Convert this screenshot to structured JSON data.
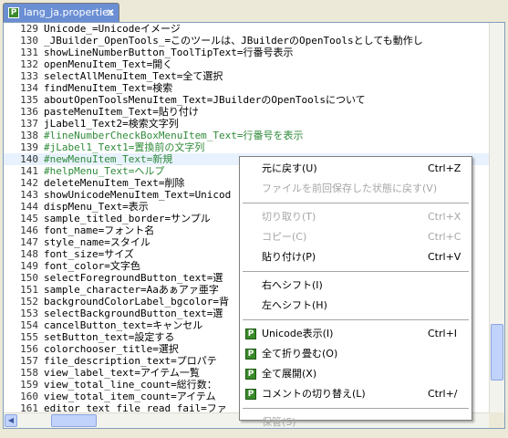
{
  "tab": {
    "label": "lang_ja.properties",
    "icon": "properties-file-icon",
    "close": "✕",
    "file_badge": "P"
  },
  "editor": {
    "lines": [
      {
        "n": "129",
        "text": "Unicode_=Unicodeイメージ",
        "comment": false
      },
      {
        "n": "130",
        "text": "_JBuilder_OpenTools_=このツールは、JBuilderのOpenToolsとしても動作し",
        "comment": false
      },
      {
        "n": "131",
        "text": "showLineNumberButton_ToolTipText=行番号表示",
        "comment": false
      },
      {
        "n": "132",
        "text": "openMenuItem_Text=開く",
        "comment": false
      },
      {
        "n": "133",
        "text": "selectAllMenuItem_Text=全て選択",
        "comment": false
      },
      {
        "n": "134",
        "text": "findMenuItem_Text=検索",
        "comment": false
      },
      {
        "n": "135",
        "text": "aboutOpenToolsMenuItem_Text=JBuilderのOpenToolsについて",
        "comment": false
      },
      {
        "n": "136",
        "text": "pasteMenuItem_Text=貼り付け",
        "comment": false
      },
      {
        "n": "137",
        "text": "jLabel1_Text2=検索文字列",
        "comment": false
      },
      {
        "n": "138",
        "text": "#lineNumberCheckBoxMenuItem_Text=行番号を表示",
        "comment": true
      },
      {
        "n": "139",
        "text": "#jLabel1_Text1=置換前の文字列",
        "comment": true
      },
      {
        "n": "140",
        "text": "#newMenuItem_Text=新規",
        "comment": true
      },
      {
        "n": "141",
        "text": "#helpMenu_Text=ヘルプ",
        "comment": true
      },
      {
        "n": "142",
        "text": "deleteMenuItem_Text=削除",
        "comment": false
      },
      {
        "n": "143",
        "text": "showUnicodeMenuItem_Text=Unicod",
        "comment": false
      },
      {
        "n": "144",
        "text": "dispMenu_Text=表示",
        "comment": false
      },
      {
        "n": "145",
        "text": "sample_titled_border=サンプル",
        "comment": false
      },
      {
        "n": "146",
        "text": "font_name=フォント名",
        "comment": false
      },
      {
        "n": "147",
        "text": "style_name=スタイル",
        "comment": false
      },
      {
        "n": "148",
        "text": "font_size=サイズ",
        "comment": false
      },
      {
        "n": "149",
        "text": "font_color=文字色",
        "comment": false
      },
      {
        "n": "150",
        "text": "selectForegroundButton_text=選",
        "comment": false
      },
      {
        "n": "151",
        "text": "sample_character=Aaあぁアァ亜字",
        "comment": false
      },
      {
        "n": "152",
        "text": "backgroundColorLabel_bgcolor=背",
        "comment": false
      },
      {
        "n": "153",
        "text": "selectBackgroundButton_text=選",
        "comment": false
      },
      {
        "n": "154",
        "text": "cancelButton_text=キャンセル",
        "comment": false
      },
      {
        "n": "155",
        "text": "setButton_text=設定する",
        "comment": false
      },
      {
        "n": "156",
        "text": "colorchooser_title=選択",
        "comment": false
      },
      {
        "n": "157",
        "text": "file_description_text=プロパテ",
        "comment": false
      },
      {
        "n": "158",
        "text": "view_label_text=アイテム一覧",
        "comment": false
      },
      {
        "n": "159",
        "text": "view_total_line_count=総行数：",
        "comment": false
      },
      {
        "n": "160",
        "text": "view_total_item_count=アイテム",
        "comment": false
      },
      {
        "n": "161",
        "text": "editor_text_file_read_fail=ファ",
        "comment": false
      }
    ],
    "current_line_index": 11
  },
  "context_menu": {
    "items": [
      {
        "type": "item",
        "label": "元に戻す(U)",
        "shortcut": "Ctrl+Z",
        "enabled": true,
        "icon": ""
      },
      {
        "type": "item",
        "label": "ファイルを前回保存した状態に戻す(V)",
        "shortcut": "",
        "enabled": false,
        "icon": ""
      },
      {
        "type": "separator"
      },
      {
        "type": "item",
        "label": "切り取り(T)",
        "shortcut": "Ctrl+X",
        "enabled": false,
        "icon": ""
      },
      {
        "type": "item",
        "label": "コピー(C)",
        "shortcut": "Ctrl+C",
        "enabled": false,
        "icon": ""
      },
      {
        "type": "item",
        "label": "貼り付け(P)",
        "shortcut": "Ctrl+V",
        "enabled": true,
        "icon": ""
      },
      {
        "type": "separator"
      },
      {
        "type": "item",
        "label": "右へシフト(I)",
        "shortcut": "",
        "enabled": true,
        "icon": ""
      },
      {
        "type": "item",
        "label": "左へシフト(H)",
        "shortcut": "",
        "enabled": true,
        "icon": ""
      },
      {
        "type": "separator"
      },
      {
        "type": "item",
        "label": "Unicode表示(I)",
        "shortcut": "Ctrl+I",
        "enabled": true,
        "icon": "plugin-icon"
      },
      {
        "type": "item",
        "label": "全て折り畳む(O)",
        "shortcut": "",
        "enabled": true,
        "icon": "plugin-icon"
      },
      {
        "type": "item",
        "label": "全て展開(X)",
        "shortcut": "",
        "enabled": true,
        "icon": "plugin-icon"
      },
      {
        "type": "item",
        "label": "コメントの切り替え(L)",
        "shortcut": "Ctrl+/",
        "enabled": true,
        "icon": "plugin-icon"
      },
      {
        "type": "separator"
      },
      {
        "type": "item",
        "label": "保管(S)",
        "shortcut": "",
        "enabled": false,
        "icon": ""
      }
    ]
  },
  "colors": {
    "tab_active": "#6b8fd4",
    "comment_green": "#2f8a3a",
    "plugin_icon": "#3a8a2a",
    "disabled_text": "#a6a6a6"
  }
}
